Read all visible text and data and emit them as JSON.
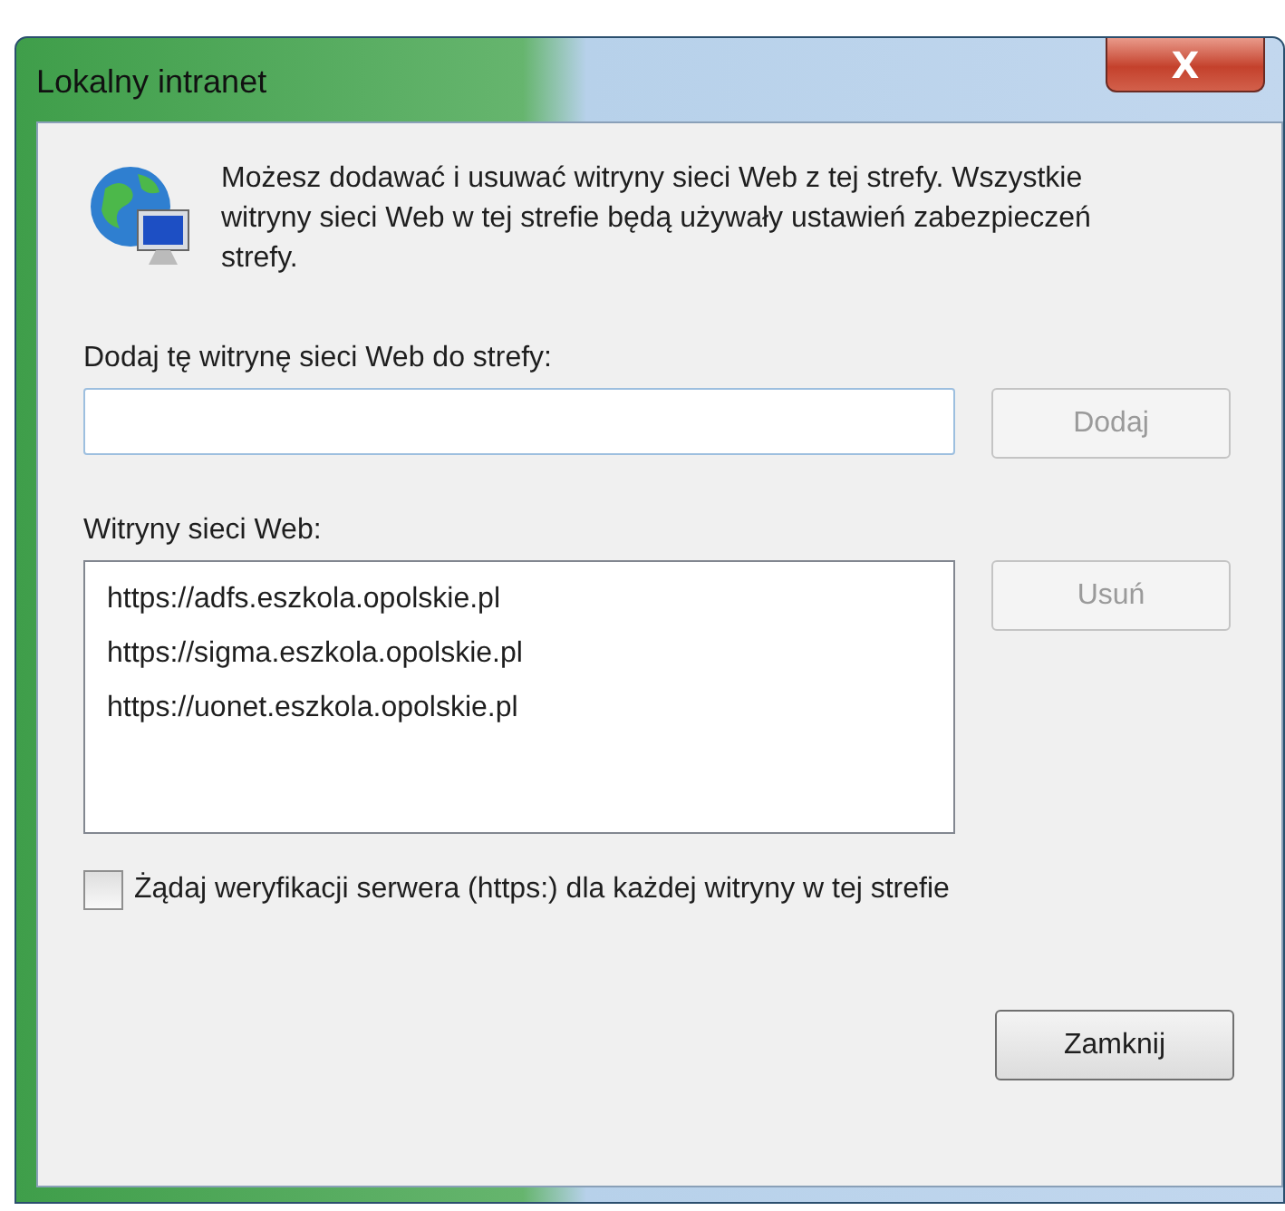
{
  "window": {
    "title": "Lokalny intranet",
    "close_glyph": "X"
  },
  "intro": "Możesz dodawać i usuwać witryny sieci Web z tej strefy. Wszystkie witryny sieci Web w tej strefie będą używały ustawień zabezpieczeń strefy.",
  "add_section": {
    "label": "Dodaj tę witrynę sieci Web do strefy:",
    "button": {
      "label": "Dodaj",
      "disabled": true
    }
  },
  "sites_section": {
    "label": "Witryny sieci Web:",
    "items": [
      {
        "text": "https://adfs.eszkola.opolskie.pl",
        "selected": false
      },
      {
        "text": "https://sigma.eszkola.opolskie.pl",
        "selected": false
      },
      {
        "text": "https://uonet.eszkola.opolskie.pl",
        "selected": false
      }
    ],
    "button": {
      "label": "Usuń",
      "disabled": true
    }
  },
  "https_check": {
    "label": "Żądaj weryfikacji serwera (https:) dla każdej witryny w tej strefie",
    "checked": false
  },
  "close_button": {
    "label": "Zamknij",
    "disabled": false
  }
}
